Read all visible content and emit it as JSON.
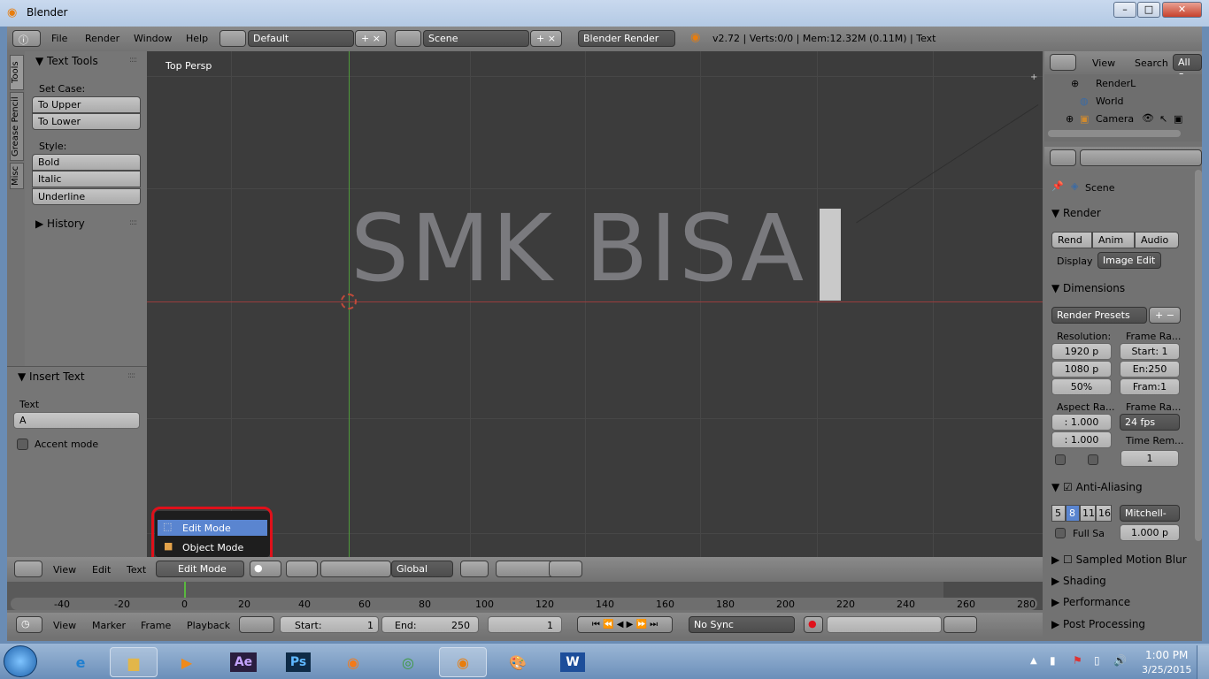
{
  "window": {
    "title": "Blender"
  },
  "topbar": {
    "menus": [
      "File",
      "Render",
      "Window",
      "Help"
    ],
    "layout": "Default",
    "scene": "Scene",
    "engine": "Blender Render",
    "stats": "v2.72 | Verts:0/0 | Mem:12.32M (0.11M) | Text"
  },
  "toolshelf": {
    "tabs": [
      "Tools",
      "Grease Pencil",
      "Misc"
    ],
    "text_tools": "Text Tools",
    "set_case": "Set Case:",
    "to_upper": "To Upper",
    "to_lower": "To Lower",
    "style": "Style:",
    "bold": "Bold",
    "italic": "Italic",
    "underline": "Underline",
    "history": "History",
    "insert_text": "Insert Text",
    "text_label": "Text",
    "text_value": "A",
    "accent_mode": "Accent mode"
  },
  "viewport": {
    "label": "Top Persp",
    "text_object": "SMK BISA"
  },
  "mode_menu": {
    "items": [
      "Edit Mode",
      "Object Mode"
    ]
  },
  "view_header": {
    "menus": [
      "View",
      "Edit",
      "Text"
    ],
    "mode": "Edit Mode",
    "orientation": "Global"
  },
  "timeline": {
    "ticks": [
      "-40",
      "-20",
      "0",
      "20",
      "40",
      "60",
      "80",
      "100",
      "120",
      "140",
      "160",
      "180",
      "200",
      "220",
      "240",
      "260",
      "280"
    ],
    "menus": [
      "View",
      "Marker",
      "Frame",
      "Playback"
    ],
    "start_label": "Start:",
    "start": "1",
    "end_label": "End:",
    "end": "250",
    "current": "1",
    "sync": "No Sync"
  },
  "outliner": {
    "view": "View",
    "search": "Search",
    "all_scenes": "All Sc",
    "items": [
      "RenderL",
      "World",
      "Camera"
    ]
  },
  "properties": {
    "scene": "Scene",
    "render": "Render",
    "rend": "Rend",
    "anim": "Anim",
    "audio": "Audio",
    "display_label": "Display",
    "display": "Image Edit",
    "dimensions": "Dimensions",
    "presets": "Render Presets",
    "resolution": "Resolution:",
    "res_x": "1920 p",
    "res_y": "1080 p",
    "res_pct": "50%",
    "frame_range": "Frame Ra...",
    "start": "Start: 1",
    "end": "En:250",
    "step": "Fram:1",
    "aspect": "Aspect Ra...",
    "aspect_x": ": 1.000",
    "aspect_y": ": 1.000",
    "frame_rate": "Frame Ra...",
    "fps": "24 fps",
    "time_remap": "Time Rem...",
    "remap_val": "1",
    "anti_aliasing": "Anti-Aliasing",
    "aa_samples": [
      "5",
      "8",
      "11",
      "16"
    ],
    "aa_filter": "Mitchell-",
    "full_sample": "Full Sa",
    "filter_size": "1.000 p",
    "sampled_motion": "Sampled Motion Blur",
    "shading": "Shading",
    "performance": "Performance",
    "post_processing": "Post Processing"
  },
  "taskbar": {
    "time": "1:00 PM",
    "date": "3/25/2015"
  }
}
